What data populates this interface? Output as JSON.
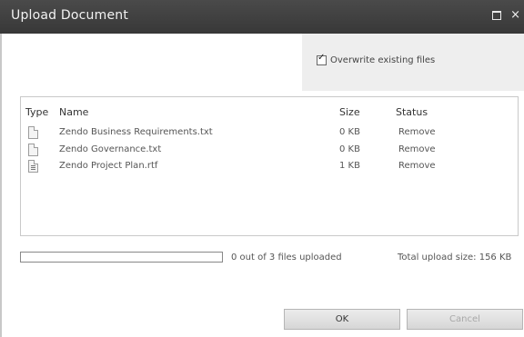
{
  "dialog": {
    "title": "Upload Document",
    "window_controls": {
      "maximize_icon": "maximize-icon",
      "close_glyph": "×"
    }
  },
  "options": {
    "overwrite_label": "Overwrite existing files",
    "overwrite_checked": true
  },
  "file_list": {
    "columns": [
      "Type",
      "Name",
      "Size",
      "Status"
    ],
    "rows": [
      {
        "icon": "text-file-icon",
        "name": "Zendo Business Requirements.txt",
        "size": "0 KB",
        "status": "Remove"
      },
      {
        "icon": "text-file-icon",
        "name": "Zendo Governance.txt",
        "size": "0 KB",
        "status": "Remove"
      },
      {
        "icon": "rtf-file-icon",
        "name": "Zendo Project Plan.rtf",
        "size": "1 KB",
        "status": "Remove"
      }
    ]
  },
  "progress": {
    "fraction": 0,
    "status_text": "0 out of 3 files uploaded",
    "total_text": "Total upload size: 156 KB"
  },
  "buttons": {
    "ok": "OK",
    "cancel": "Cancel"
  }
}
